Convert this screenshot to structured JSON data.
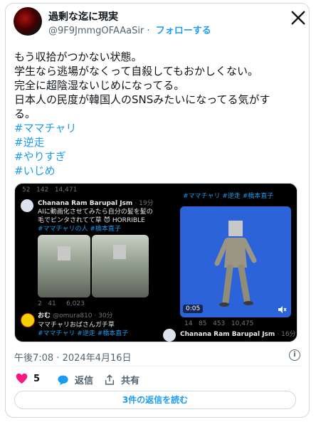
{
  "author": {
    "name": "過剰な迄に現実",
    "handle": "@9F9JmmgOFAAaSir",
    "separator": "·",
    "follow_label": "フォローする"
  },
  "tweet": {
    "lines": [
      "もう収拾がつかない状態。",
      "学生なら逃場がなくって自殺してもおかしくない。",
      "完全に超陰湿ないじめになってる。",
      "日本人の民度が韓国人のSNSみたいになってる気がす",
      "る。"
    ],
    "hashtags": [
      "#ママチャリ",
      "#逆走",
      "#やりすぎ",
      "#いじめ"
    ]
  },
  "media": {
    "left": {
      "top_stats": [
        "52",
        "142",
        "14,471"
      ],
      "post1_name": "Chanana Ram Barupal Jsm",
      "post1_time": "· 19分",
      "post1_lines": [
        "AIに動画化させてみたら自分の髪を髪の",
        "毛でピンタされてて草 😈 HORRIBLE"
      ],
      "post1_tags": "#ママチャリの人 #橋本直子",
      "bottom_stats": [
        "2",
        "41",
        "6,023"
      ],
      "post2_name": "おむ",
      "post2_handle": "@omura810 · 30分",
      "post2_line": "ママチャリおばさんガチ草",
      "post2_tags": "#ママチャリ #逆走 #橋本直子"
    },
    "right": {
      "tags": "#ママチャリ #逆走 #橋本直子",
      "video_time": "0:05",
      "stats": [
        "14",
        "85",
        "453",
        "10,475"
      ],
      "post_name": "Chanana Ram Barupal Jsm",
      "post_time": "· 16分"
    }
  },
  "meta": {
    "timestamp": "午後7:08 · 2024年4月16日",
    "likes": "5",
    "reply_label": "返信",
    "share_label": "共有",
    "read_replies": "3件の返信を読む"
  },
  "colors": {
    "accent": "#1d9bf0",
    "like": "#f91880",
    "text": "#0f1419",
    "muted": "#536471"
  },
  "icons": [
    "x-logo-icon",
    "info-icon",
    "heart-icon",
    "reply-icon",
    "share-icon",
    "mute-icon"
  ]
}
